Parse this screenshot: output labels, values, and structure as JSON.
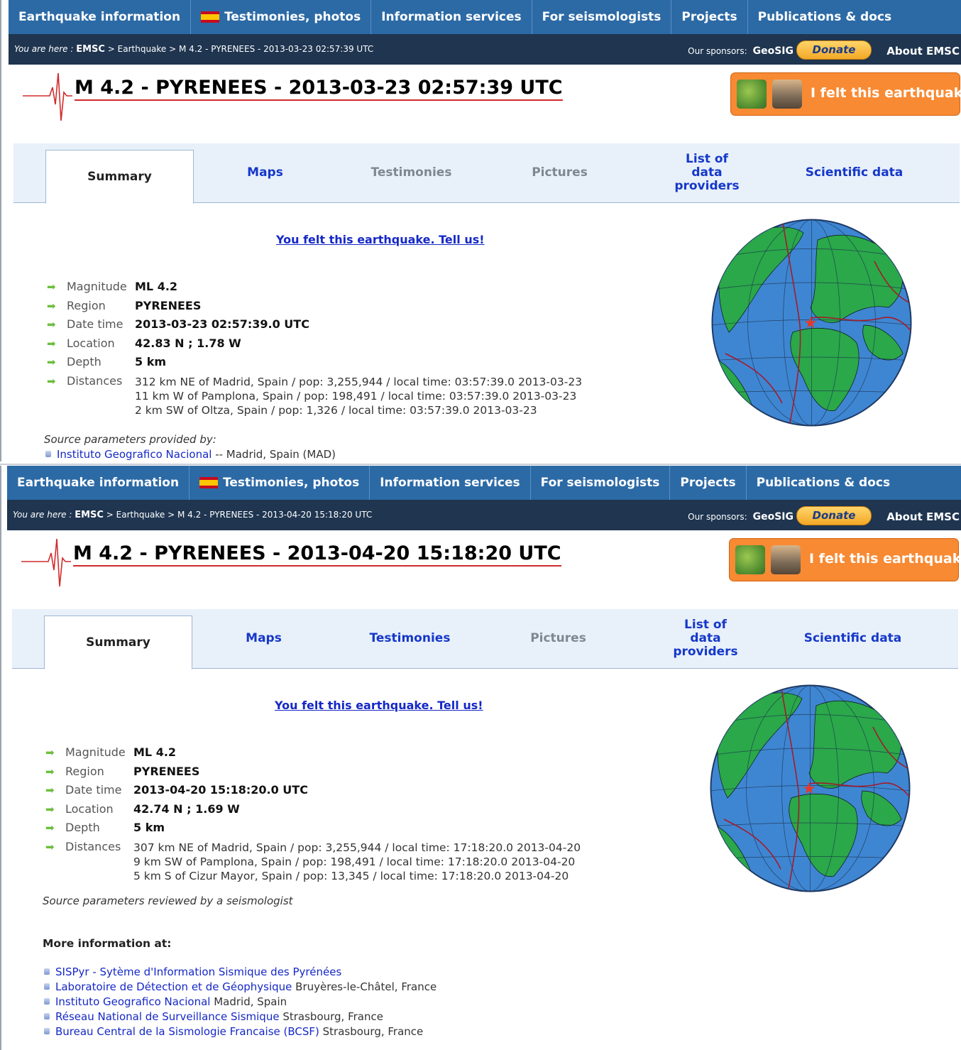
{
  "nav": {
    "items": [
      "Earthquake information",
      "Testimonies, photos",
      "Information services",
      "For seismologists",
      "Projects",
      "Publications & docs"
    ]
  },
  "header": {
    "you_are_here": "You are here : ",
    "crumb_root": "EMSC",
    "crumb_sep": " > ",
    "crumb_earthquake": "Earthquake",
    "sponsors_label": "Our sponsors:",
    "sponsor_name": "GeoSIG",
    "donate": "Donate",
    "about": "About EMSC"
  },
  "felt_button": "I felt this earthquake",
  "tabs": [
    "Summary",
    "Maps",
    "Testimonies",
    "Pictures",
    "List of data providers",
    "Scientific data"
  ],
  "tell_us": "You felt this earthquake. Tell us!",
  "labels": {
    "magnitude": "Magnitude",
    "region": "Region",
    "datetime": "Date time",
    "location": "Location",
    "depth": "Depth",
    "distances": "Distances"
  },
  "event1": {
    "crumb_event": "M 4.2 - PYRENEES - 2013-03-23 02:57:39 UTC",
    "title": "M 4.2 - PYRENEES - 2013-03-23 02:57:39 UTC",
    "magnitude": "ML 4.2",
    "region": "PYRENEES",
    "datetime": "2013-03-23 02:57:39.0 UTC",
    "location": "42.83 N ; 1.78 W",
    "depth": "5 km",
    "distances": [
      "312 km NE of Madrid, Spain / pop: 3,255,944 / local time: 03:57:39.0 2013-03-23",
      "11 km W of Pamplona, Spain / pop: 198,491 / local time: 03:57:39.0 2013-03-23",
      "2 km SW of Oltza, Spain / pop: 1,326 / local time: 03:57:39.0 2013-03-23"
    ],
    "source_note": "Source parameters provided by:",
    "provider_link": "Instituto Geografico Nacional",
    "provider_text": " -- Madrid, Spain (MAD)",
    "testimonies_enabled": false
  },
  "event2": {
    "crumb_event": "M 4.2 - PYRENEES - 2013-04-20 15:18:20 UTC",
    "title": "M 4.2 - PYRENEES - 2013-04-20 15:18:20 UTC",
    "magnitude": "ML 4.2",
    "region": "PYRENEES",
    "datetime": "2013-04-20 15:18:20.0 UTC",
    "location": "42.74 N ; 1.69 W",
    "depth": "5 km",
    "distances": [
      "307 km NE of Madrid, Spain / pop: 3,255,944 / local time: 17:18:20.0 2013-04-20",
      "9 km SW of Pamplona, Spain / pop: 198,491 / local time: 17:18:20.0 2013-04-20",
      "5 km S of Cizur Mayor, Spain / pop: 13,345 / local time: 17:18:20.0 2013-04-20"
    ],
    "source_note": "Source parameters reviewed by a seismologist",
    "more_info_title": "More information at:",
    "more_info": [
      {
        "link": "SISPyr - Sytème d'Information Sismique des Pyrénées",
        "text": ""
      },
      {
        "link": "Laboratoire de Détection et de Géophysique",
        "text": " Bruyères-le-Châtel, France"
      },
      {
        "link": "Instituto Geografico Nacional",
        "text": " Madrid, Spain"
      },
      {
        "link": "Réseau National de Surveillance Sismique",
        "text": " Strasbourg, France"
      },
      {
        "link": "Bureau Central de la Sismologie Francaise (BCSF)",
        "text": " Strasbourg, France"
      }
    ],
    "testimonies_enabled": true
  },
  "colors": {
    "nav_bg": "#2c6aa6",
    "crumb_bg": "#1f3550",
    "felt_btn": "#f88a33",
    "link": "#1528c6",
    "epicenter": "#e33b2b"
  }
}
